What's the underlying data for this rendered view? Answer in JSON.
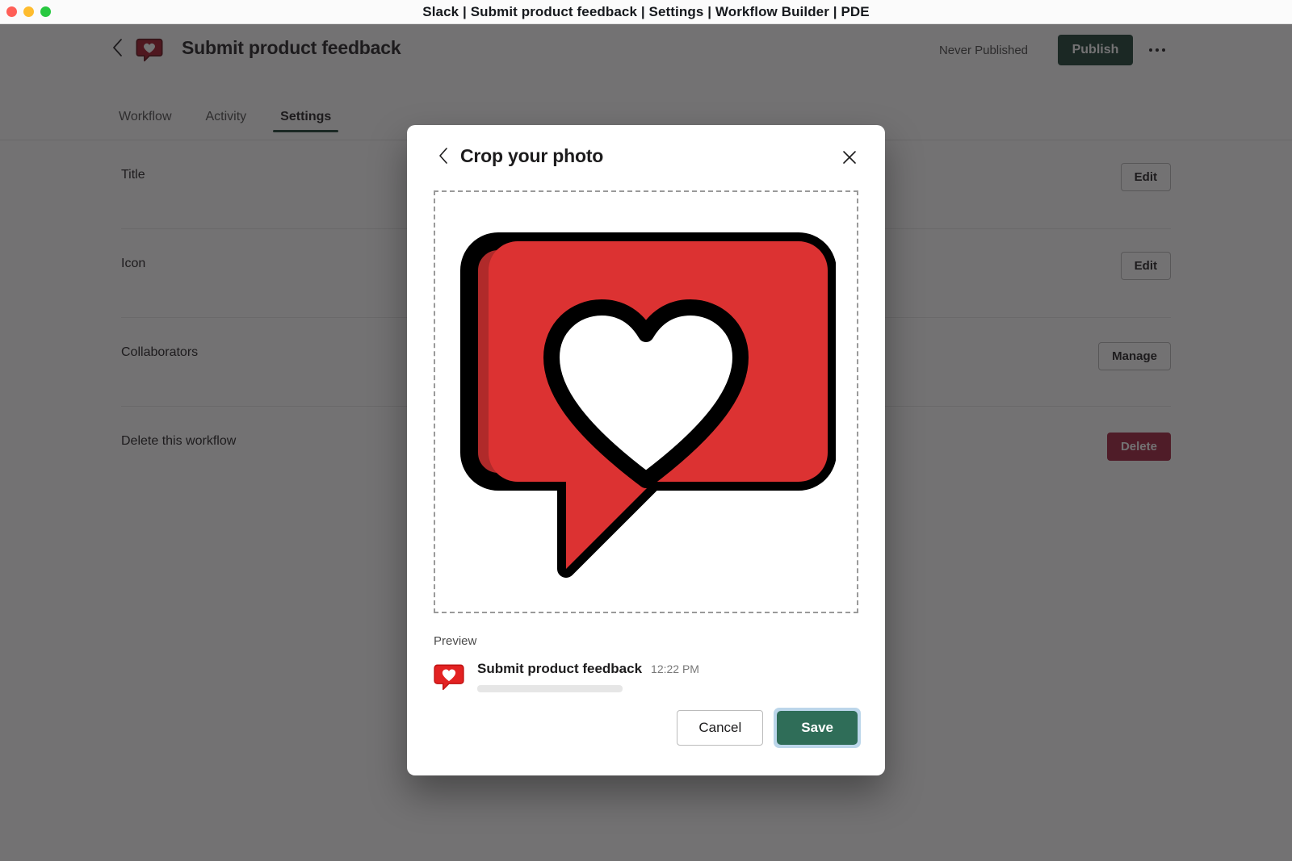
{
  "window": {
    "title": "Slack | Submit product feedback | Settings | Workflow Builder | PDE",
    "controls": {
      "close": "close",
      "minimize": "minimize",
      "zoom": "zoom"
    }
  },
  "workflow": {
    "back_icon": "chevron-left-icon",
    "app_icon": "speech-bubble-heart-icon",
    "title": "Submit product feedback",
    "publish_status": "Never Published",
    "publish_label": "Publish",
    "overflow_icon": "ellipsis-icon"
  },
  "tabs": [
    {
      "label": "Workflow",
      "active": false
    },
    {
      "label": "Activity",
      "active": false
    },
    {
      "label": "Settings",
      "active": true
    }
  ],
  "settings_rows": [
    {
      "label": "Title",
      "action": "Edit",
      "action_kind": "outline"
    },
    {
      "label": "Icon",
      "action": "Edit",
      "action_kind": "outline"
    },
    {
      "label": "Collaborators",
      "action": "Manage",
      "action_kind": "outline"
    },
    {
      "label": "Delete this workflow",
      "action": "Delete",
      "action_kind": "danger"
    }
  ],
  "modal": {
    "back_icon": "chevron-left-icon",
    "title": "Crop your photo",
    "close_icon": "close-icon",
    "crop": {
      "image_alt": "speech-bubble-heart-icon",
      "border_style": "dashed"
    },
    "preview": {
      "label": "Preview",
      "avatar_icon": "speech-bubble-heart-icon",
      "name": "Submit product feedback",
      "time": "12:22 PM"
    },
    "footer": {
      "cancel_label": "Cancel",
      "save_label": "Save"
    }
  },
  "colors": {
    "brand_green": "#1a3d31",
    "save_green": "#2f6d58",
    "focus_ring": "#bcd6ea",
    "danger_red": "#a01e3c",
    "icon_red": "#dc3232",
    "icon_red_shadow": "#b3262a",
    "overlay": "rgba(29,28,29,0.62)"
  }
}
